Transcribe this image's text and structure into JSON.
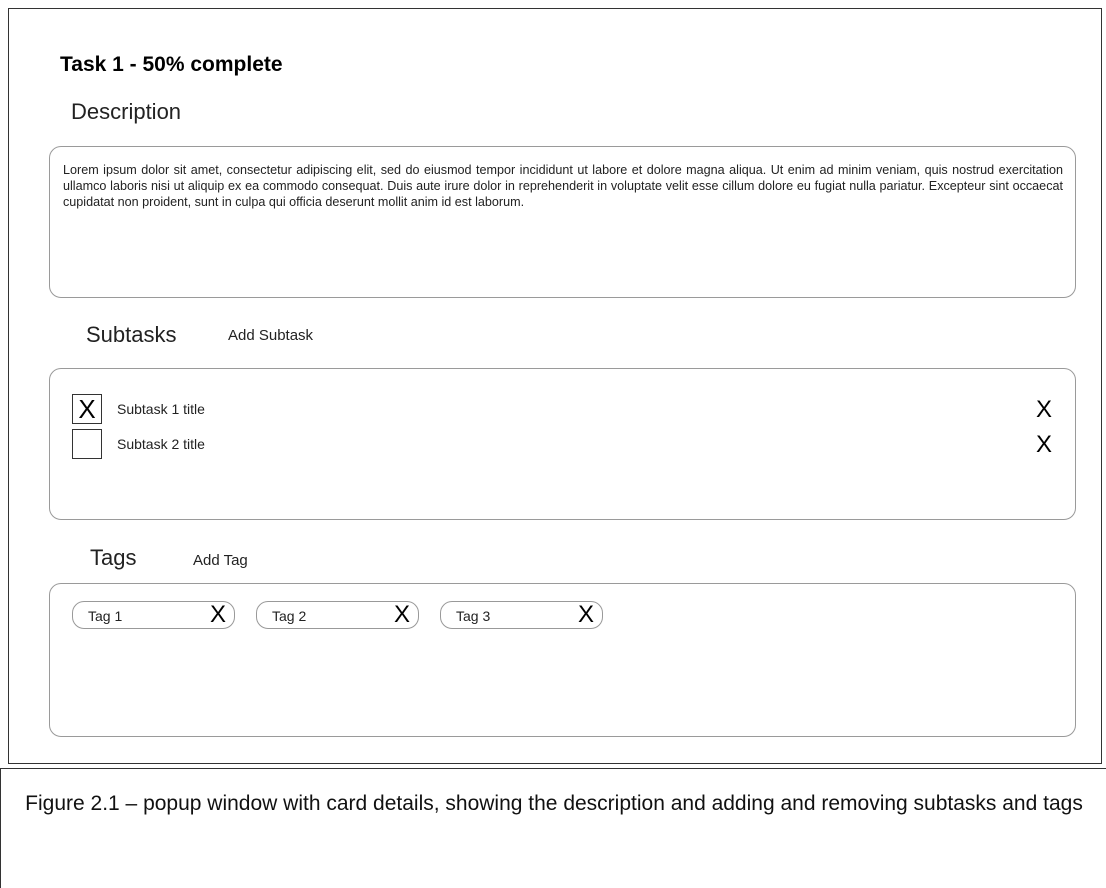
{
  "popup": {
    "title": "Task 1 - 50% complete",
    "description": {
      "label": "Description",
      "text": "Lorem ipsum dolor sit amet, consectetur adipiscing elit, sed do eiusmod tempor incididunt ut labore et dolore magna aliqua. Ut enim ad minim veniam, quis nostrud exercitation ullamco laboris nisi ut aliquip ex ea commodo consequat. Duis aute irure dolor in reprehenderit in voluptate velit esse cillum dolore eu fugiat nulla pariatur. Excepteur sint occaecat cupidatat non proident, sunt in culpa qui officia deserunt mollit anim id est laborum."
    },
    "subtasks": {
      "label": "Subtasks",
      "add_label": "Add Subtask",
      "items": [
        {
          "title": "Subtask 1 title",
          "checked_mark": "X",
          "remove_label": "X"
        },
        {
          "title": "Subtask 2 title",
          "checked_mark": "",
          "remove_label": "X"
        }
      ]
    },
    "tags": {
      "label": "Tags",
      "add_label": "Add Tag",
      "items": [
        {
          "name": "Tag 1",
          "remove_label": "X"
        },
        {
          "name": "Tag 2",
          "remove_label": "X"
        },
        {
          "name": "Tag 3",
          "remove_label": "X"
        }
      ]
    }
  },
  "caption": "Figure 2.1 – popup window with card details, showing the description and adding and removing subtasks and tags"
}
